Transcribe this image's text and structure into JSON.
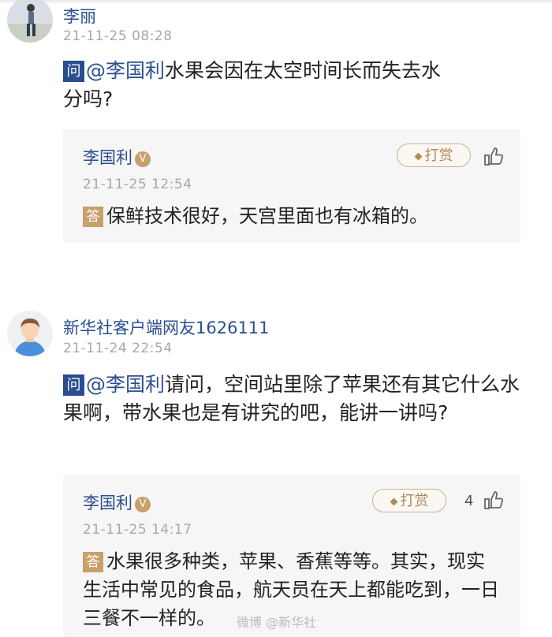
{
  "items": [
    {
      "user": "李丽",
      "time": "21-11-25 08:28",
      "q_tag": "问",
      "mention": "@李国利",
      "question": "水果会因在太空时间长而失去水分吗?",
      "reply": {
        "name": "李国利",
        "verified": "V",
        "tip_label": "打赏",
        "like_count": "",
        "time": "21-11-25 12:54",
        "a_tag": "答",
        "answer": "保鲜技术很好，天宫里面也有冰箱的。"
      }
    },
    {
      "user": "新华社客户端网友1626111",
      "time": "21-11-24 22:54",
      "q_tag": "问",
      "mention": "@李国利",
      "question": "请问，空间站里除了苹果还有其它什么水果啊，带水果也是有讲究的吧，能讲一讲吗?",
      "reply": {
        "name": "李国利",
        "verified": "V",
        "tip_label": "打赏",
        "like_count": "4",
        "time": "21-11-25 14:17",
        "a_tag": "答",
        "answer": "水果很多种类，苹果、香蕉等等。其实，现实生活中常见的食品，航天员在天上都能吃到，一日三餐不一样的。"
      }
    }
  ],
  "watermark": "微博 @新华社"
}
